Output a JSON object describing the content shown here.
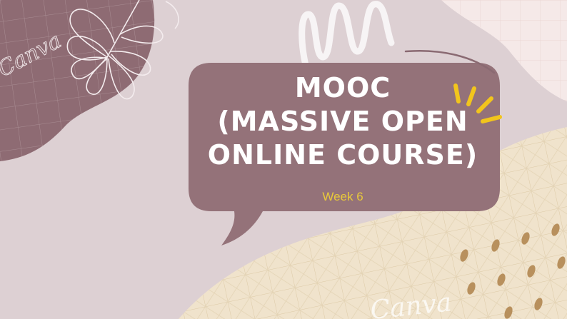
{
  "slide": {
    "title_lines": [
      "MOOC",
      "(MASSIVE OPEN",
      "ONLINE COURSE)"
    ],
    "subtitle": "Week 6",
    "watermarks": [
      "Canva",
      "Canva"
    ]
  },
  "colors": {
    "background": "#ddd0d3",
    "bubble": "#947279",
    "blob_dark": "#8e6b73",
    "cream": "#f0e3cc",
    "pink": "#f5e9e8",
    "title_text": "#ffffff",
    "subtitle_text": "#e8c93a",
    "spark": "#f2c51c",
    "dots": "#b8905d"
  },
  "icons": [
    "canva-watermark-icon",
    "leaf-outline-icon",
    "squiggle-icon",
    "sparkle-lines-icon"
  ]
}
